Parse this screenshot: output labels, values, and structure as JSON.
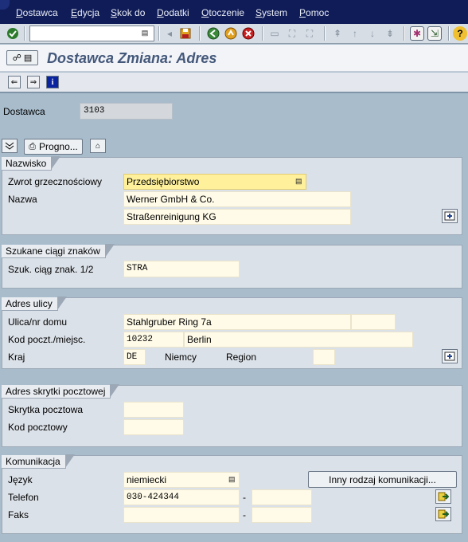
{
  "menu": [
    "Dostawca",
    "Edycja",
    "Skok do",
    "Dodatki",
    "Otoczenie",
    "System",
    "Pomoc"
  ],
  "title": "Dostawca Zmiana: Adres",
  "vendor": {
    "label": "Dostawca",
    "value": "3103"
  },
  "toolbar2": {
    "prognoza_label": "Progno..."
  },
  "nazwisko": {
    "title": "Nazwisko",
    "form_label": "Zwrot grzecznościowy",
    "form_value": "Przedsiębiorstwo",
    "name_label": "Nazwa",
    "name1": "Werner GmbH & Co.",
    "name2": "Straßenreinigung KG"
  },
  "search": {
    "title": "Szukane ciągi znaków",
    "label": "Szuk. ciąg znak. 1/2",
    "value": "STRA",
    "value2": ""
  },
  "street": {
    "title": "Adres ulicy",
    "street_label": "Ulica/nr domu",
    "street_value": "Stahlgruber Ring 7a",
    "house_no": "",
    "postal_label": "Kod poczt./miejsc.",
    "postal_value": "10232",
    "city_value": "Berlin",
    "country_label": "Kraj",
    "country_code": "DE",
    "country_name": "Niemcy",
    "region_label": "Region",
    "region_value": ""
  },
  "pobox": {
    "title": "Adres skrytki pocztowej",
    "box_label": "Skrytka pocztowa",
    "box_value": "",
    "postal_label": "Kod pocztowy",
    "postal_value": ""
  },
  "comm": {
    "title": "Komunikacja",
    "lang_label": "Język",
    "lang_value": "niemiecki",
    "other_button": "Inny rodzaj komunikacji...",
    "phone_label": "Telefon",
    "phone_value": "030-424344",
    "phone_ext": "",
    "fax_label": "Faks",
    "fax_value": "",
    "fax_ext": "",
    "dash": "-"
  },
  "icons": {
    "enter": "check-icon",
    "save": "save-icon",
    "back": "back-icon",
    "exit": "exit-icon",
    "cancel": "cancel-icon",
    "help": "help-icon",
    "expand": "expand-icon"
  },
  "colors": {
    "menubar": "#101c58",
    "background": "#a8bccc",
    "title": "#44587a",
    "required": "#fff19c"
  }
}
